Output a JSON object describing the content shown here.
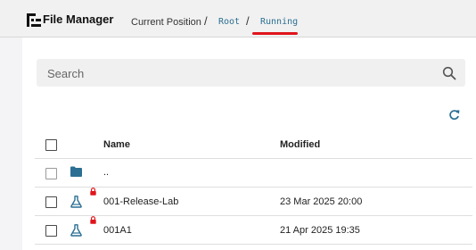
{
  "app": {
    "title": "File Manager",
    "logo_icon": "file-manager-logo-icon"
  },
  "breadcrumb": {
    "label": "Current Position",
    "separator": "/",
    "items": [
      {
        "label": "Root"
      },
      {
        "label": "Running",
        "active": true
      }
    ],
    "active_underline_color": "#e0151b",
    "link_color": "#2b6f93"
  },
  "search": {
    "placeholder": "Search",
    "value": "",
    "icon": "search-icon"
  },
  "toolbar": {
    "refresh_icon": "refresh-icon",
    "refresh_color": "#2b6f93"
  },
  "table": {
    "columns": {
      "name": "Name",
      "modified": "Modified"
    },
    "rows": [
      {
        "type": "parent-folder",
        "icon": "folder-icon",
        "name": "..",
        "modified": ""
      },
      {
        "type": "lab",
        "icon": "flask-icon",
        "locked": true,
        "name": "001-Release-Lab",
        "modified": "23 Mar 2025 20:00"
      },
      {
        "type": "lab",
        "icon": "flask-icon",
        "locked": true,
        "name": "001A1",
        "modified": "21 Apr 2025 19:35"
      }
    ]
  },
  "colors": {
    "icon_blue": "#2b6f93",
    "lock_red": "#e0151b"
  }
}
